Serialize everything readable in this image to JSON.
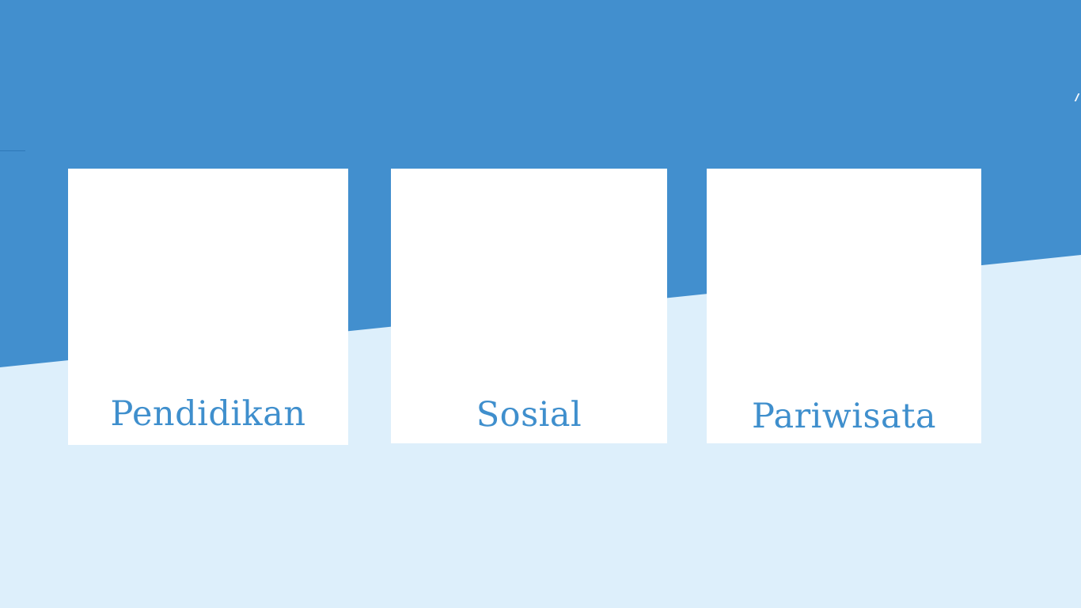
{
  "colors": {
    "primary_blue": "#428fce",
    "light_blue": "#ddeffb",
    "card_background": "#ffffff",
    "label_text": "#3f8fcd"
  },
  "categories": [
    {
      "label": "Pendidikan"
    },
    {
      "label": "Sosial"
    },
    {
      "label": "Pariwisata"
    }
  ]
}
